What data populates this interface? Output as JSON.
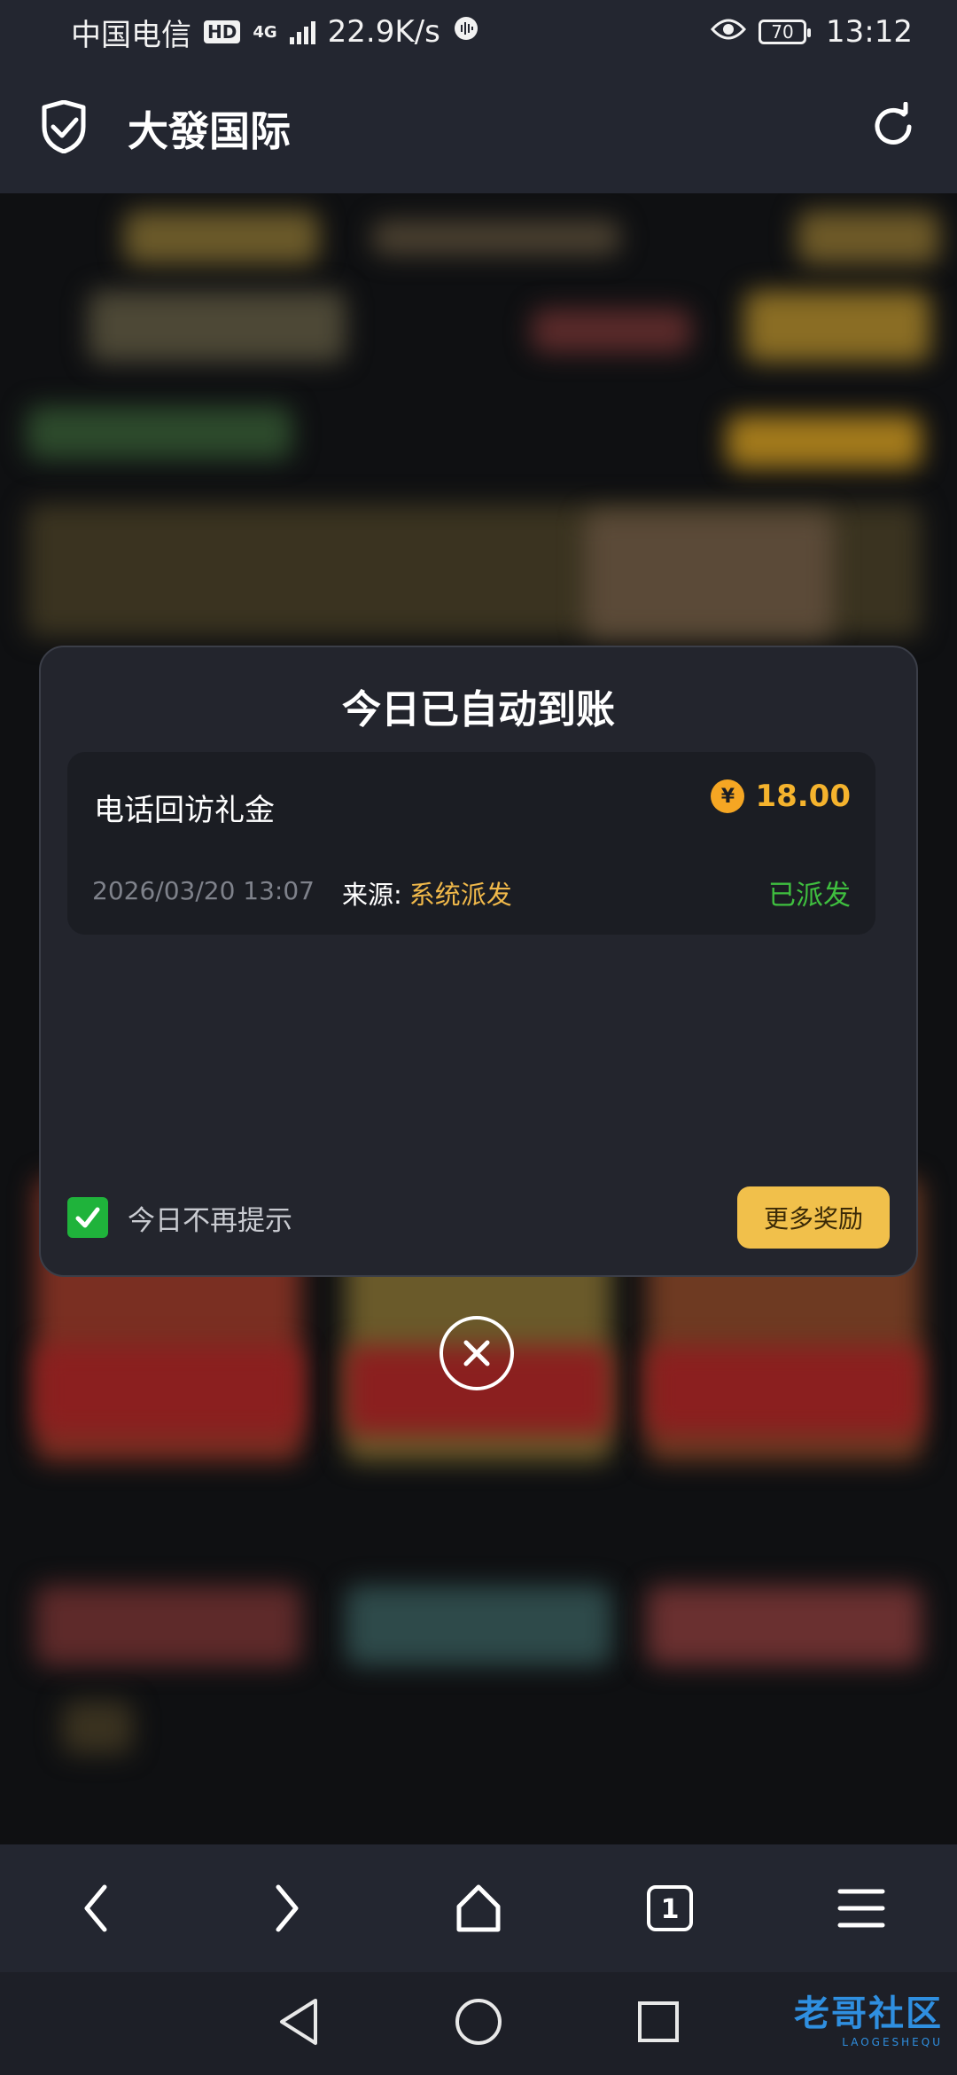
{
  "status_bar": {
    "carrier": "中国电信",
    "hd_badge": "HD",
    "network": "4G",
    "speed": "22.9K/s",
    "battery": "70",
    "time": "13:12"
  },
  "browser": {
    "site_title": "大發国际",
    "shield_icon": "shield-check-icon",
    "refresh_icon": "refresh-icon"
  },
  "modal": {
    "title": "今日已自动到账",
    "reward": {
      "name": "电话回访礼金",
      "currency_symbol": "¥",
      "amount": "18.00",
      "datetime": "2026/03/20 13:07",
      "source_label": "来源:",
      "source_value": "系统派发",
      "status": "已派发"
    },
    "dont_remind_label": "今日不再提示",
    "dont_remind_checked": true,
    "more_rewards_label": "更多奖励"
  },
  "toolbar": {
    "back_icon": "chevron-left-icon",
    "forward_icon": "chevron-right-icon",
    "home_icon": "home-icon",
    "tab_count": "1",
    "menu_icon": "menu-icon"
  },
  "nav": {
    "back_icon": "nav-back-icon",
    "home_icon": "nav-home-icon",
    "recents_icon": "nav-recents-icon"
  },
  "watermark": {
    "text": "老哥社区",
    "sub": "LAOGESHEQU"
  },
  "colors": {
    "accent_gold": "#f1c04b",
    "amount_orange": "#f5b32d",
    "status_green": "#3fbf3f",
    "modal_bg": "#23252d"
  }
}
